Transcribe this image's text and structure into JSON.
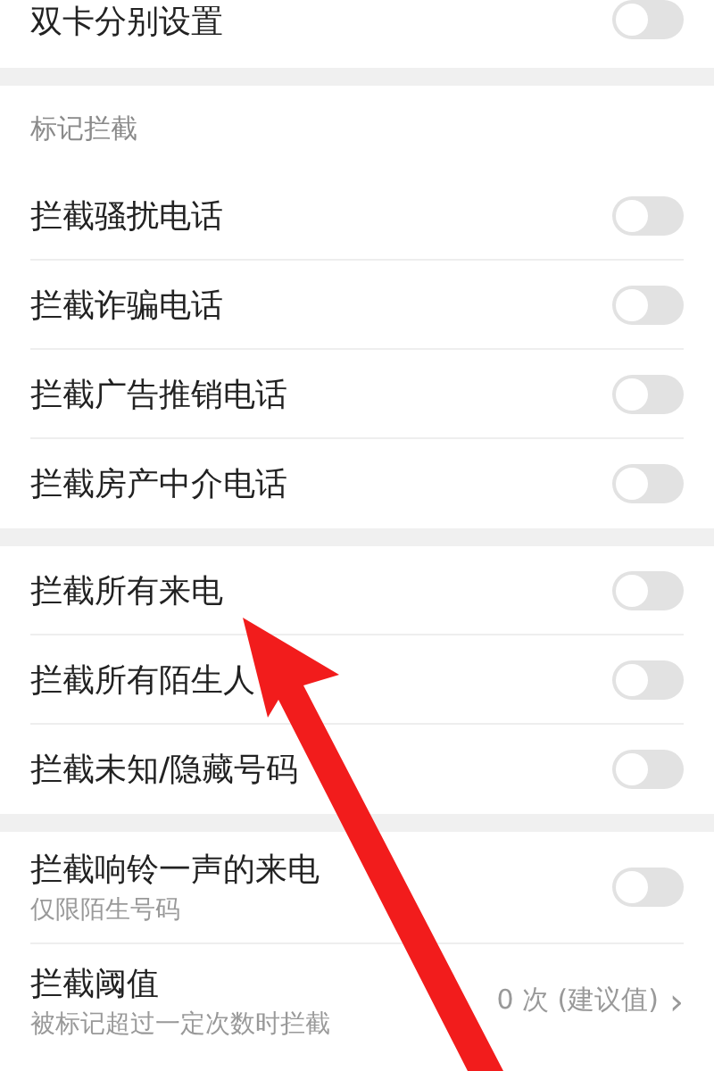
{
  "sections": [
    {
      "items": [
        {
          "kind": "switch",
          "label": "双卡分别设置",
          "on": false
        }
      ]
    },
    {
      "header": "标记拦截",
      "items": [
        {
          "kind": "switch",
          "label": "拦截骚扰电话",
          "on": false
        },
        {
          "kind": "switch",
          "label": "拦截诈骗电话",
          "on": false
        },
        {
          "kind": "switch",
          "label": "拦截广告推销电话",
          "on": false
        },
        {
          "kind": "switch",
          "label": "拦截房产中介电话",
          "on": false
        }
      ]
    },
    {
      "items": [
        {
          "kind": "switch",
          "label": "拦截所有来电",
          "on": false
        },
        {
          "kind": "switch",
          "label": "拦截所有陌生人",
          "on": false
        },
        {
          "kind": "switch",
          "label": "拦截未知/隐藏号码",
          "on": false
        }
      ]
    },
    {
      "items": [
        {
          "kind": "switch",
          "label": "拦截响铃一声的来电",
          "subtitle": "仅限陌生号码",
          "on": false
        },
        {
          "kind": "value",
          "label": "拦截阈值",
          "subtitle": "被标记超过一定次数时拦截",
          "value": "0 次 (建议值)",
          "chevron": "›"
        }
      ]
    }
  ]
}
